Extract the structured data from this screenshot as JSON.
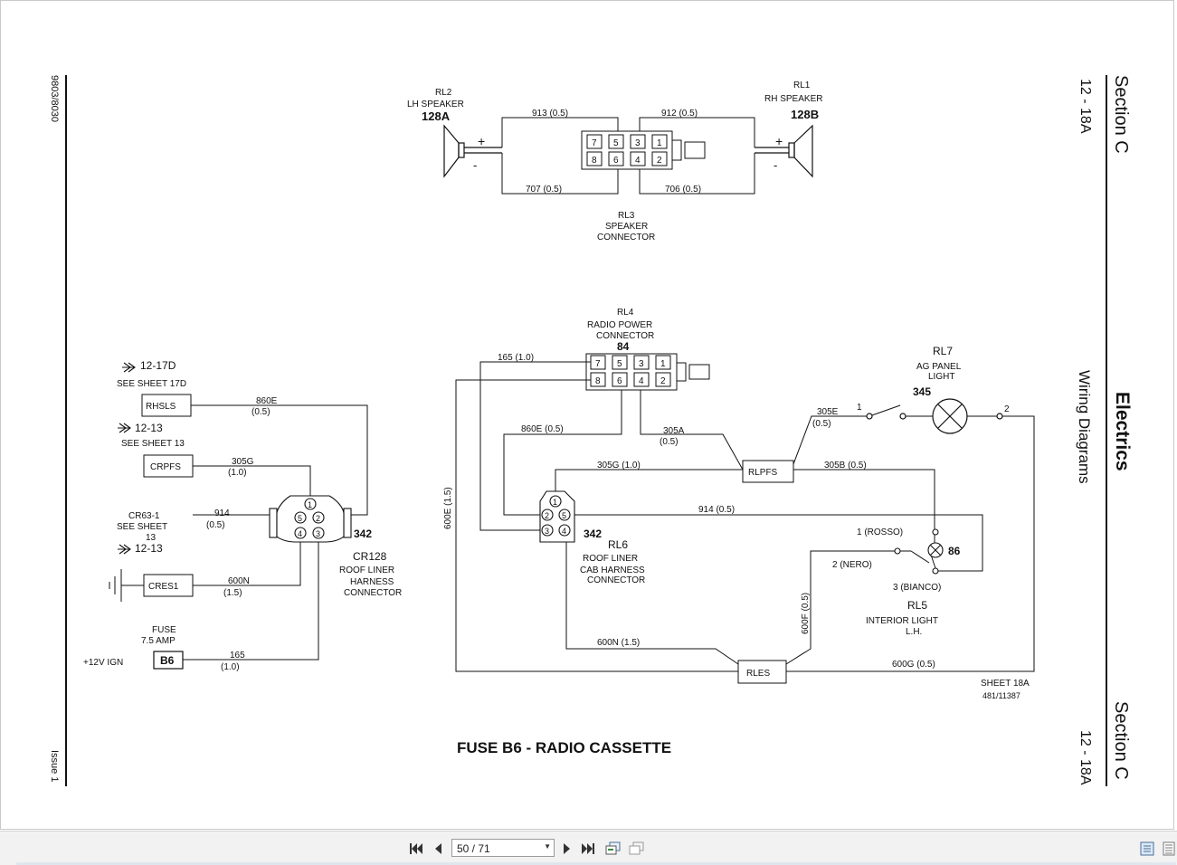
{
  "document": {
    "left_margin": {
      "doc_number": "9803/8030",
      "issue": "Issue 1"
    },
    "right_margin": {
      "section_top": "Section C",
      "page_top": "12 - 18A",
      "title": "Electrics",
      "subtitle": "Wiring Diagrams",
      "section_bottom": "Section C",
      "page_bottom": "12 - 18A"
    },
    "main_title": "FUSE B6 - RADIO CASSETTE",
    "sheet_ref": "SHEET 18A",
    "drawing_no": "481/11387"
  },
  "speakers": {
    "lh": {
      "code": "RL2",
      "name": "LH SPEAKER",
      "ref": "128A",
      "plus": "+",
      "minus": "-"
    },
    "rh": {
      "code": "RL1",
      "name": "RH SPEAKER",
      "ref": "128B",
      "plus": "+",
      "minus": "-"
    },
    "wires": {
      "w913": "913 (0.5)",
      "w912": "912 (0.5)",
      "w707": "707 (0.5)",
      "w706": "706 (0.5)"
    },
    "connector": {
      "code": "RL3",
      "line1": "SPEAKER",
      "line2": "CONNECTOR",
      "top_pins": [
        "7",
        "5",
        "3",
        "1"
      ],
      "bottom_pins": [
        "8",
        "6",
        "4",
        "2"
      ]
    }
  },
  "radio_power": {
    "code": "RL4",
    "line1": "RADIO POWER",
    "line2": "CONNECTOR",
    "ref": "84",
    "top_pins": [
      "7",
      "5",
      "3",
      "1"
    ],
    "bottom_pins": [
      "8",
      "6",
      "4",
      "2"
    ],
    "w165": "165 (1.0)",
    "w860e": "860E (0.5)",
    "w305a": "305A",
    "w305a_g": "(0.5)",
    "w600e": "600E (1.5)"
  },
  "ag_panel": {
    "code": "RL7",
    "line1": "AG PANEL",
    "line2": "LIGHT",
    "ref": "345",
    "w305e": "305E",
    "w305e_g": "(0.5)",
    "pin1": "1",
    "pin2": "2"
  },
  "rlpfs": {
    "label": "RLPFS",
    "w305g": "305G (1.0)",
    "w305b": "305B (0.5)"
  },
  "rl6": {
    "ref": "342",
    "code": "RL6",
    "line1": "ROOF LINER",
    "line2": "CAB HARNESS",
    "line3": "CONNECTOR",
    "pins": [
      "1",
      "2",
      "5",
      "3",
      "4"
    ],
    "w914": "914 (0.5)"
  },
  "rl5": {
    "code": "RL5",
    "line1": "INTERIOR LIGHT",
    "line2": "L.H.",
    "ref": "86",
    "rosso": "1 (ROSSO)",
    "nero": "2 (NERO)",
    "bianco": "3 (BIANCO)",
    "w600f": "600F (0.5)"
  },
  "rles": {
    "label": "RLES",
    "w600n": "600N (1.5)",
    "w600g": "600G (0.5)"
  },
  "left_side": {
    "ref17d": "12-17D",
    "see17d": "SEE SHEET 17D",
    "rhsls": "RHSLS",
    "w860e": "860E",
    "w860e_g": "(0.5)",
    "ref13a": "12-13",
    "see13": "SEE SHEET 13",
    "crpfs": "CRPFS",
    "w305g": "305G",
    "w305g_g": "(1.0)",
    "cr63": "CR63-1",
    "cr63_see": "SEE SHEET",
    "cr63_num": "13",
    "w914": "914",
    "w914_g": "(0.5)",
    "ref13b": "12-13",
    "cres1": "CRES1",
    "w600n": "600N",
    "w600n_g": "(1.5)",
    "fuse": "FUSE",
    "amp": "7.5 AMP",
    "ign": "+12V IGN",
    "b6": "B6",
    "w165": "165",
    "w165_g": "(1.0)",
    "cr128_ref": "342",
    "cr128_code": "CR128",
    "cr128_l1": "ROOF LINER",
    "cr128_l2": "HARNESS",
    "cr128_l3": "CONNECTOR",
    "pins": [
      "1",
      "5",
      "2",
      "4",
      "3"
    ]
  },
  "viewer": {
    "page_indicator": "50 / 71",
    "icons": [
      "first-page-icon",
      "prev-page-icon",
      "next-page-icon",
      "last-page-icon",
      "continuous-view-icon",
      "single-page-view-icon",
      "page-layout-icon",
      "scroll-mode-icon"
    ]
  }
}
